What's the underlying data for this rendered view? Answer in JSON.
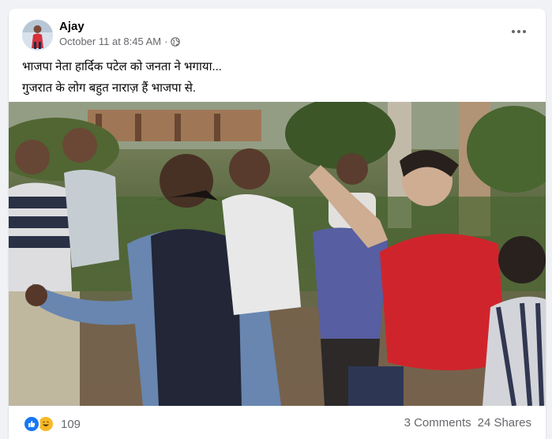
{
  "post": {
    "author": "Ajay",
    "timestamp": "October 11 at 8:45 AM",
    "separator": "·",
    "privacy_icon": "globe-icon",
    "more_icon": "more-options-icon",
    "caption_line1": "भाजपा नेता हार्दिक पटेल को जनता ने भगाया...",
    "caption_line2": "गुजरात के लोग बहुत नाराज़ हैं भाजपा से."
  },
  "footer": {
    "reaction_icons": [
      "like-reaction-icon",
      "haha-reaction-icon"
    ],
    "reaction_count": "109",
    "comments": "3 Comments",
    "shares": "24 Shares"
  },
  "colors": {
    "background": "#f0f2f5",
    "card": "#ffffff",
    "text_primary": "#050505",
    "text_secondary": "#65676b",
    "like_blue": "#1877f2",
    "haha_yellow": "#f7b928"
  }
}
